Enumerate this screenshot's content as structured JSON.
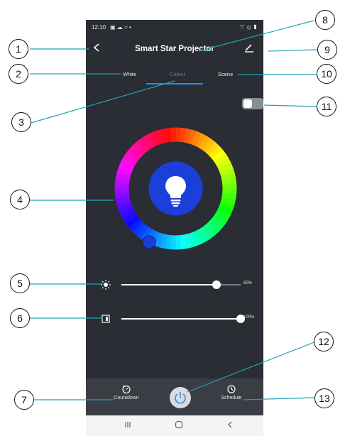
{
  "status": {
    "time": "12:10",
    "icons": "▣ ☁ ○ •",
    "right_icons": "⌔ ⦸ ▮"
  },
  "header": {
    "title": "Smart Star Projector"
  },
  "tabs": [
    {
      "label": "White"
    },
    {
      "label": "Colour",
      "active": true
    },
    {
      "label": "Scene"
    }
  ],
  "colour": {
    "current_color": "#1a40d9",
    "wheel_colors": [
      "#ff3030",
      "#ff00c8",
      "#8a2bff",
      "#1a40d9",
      "#00b8ff",
      "#00e676",
      "#c6ff00",
      "#ffeb00",
      "#ff8a00"
    ]
  },
  "brightness": {
    "value_label": "80%",
    "level": 0.8
  },
  "saturation": {
    "value_label": "100%",
    "level": 1.0
  },
  "bottom": {
    "countdown_label": "Countdown",
    "schedule_label": "Schedule"
  },
  "callouts": [
    "1",
    "2",
    "3",
    "4",
    "5",
    "6",
    "7",
    "8",
    "9",
    "10",
    "11",
    "12",
    "13"
  ],
  "accent": "#2c8be6"
}
